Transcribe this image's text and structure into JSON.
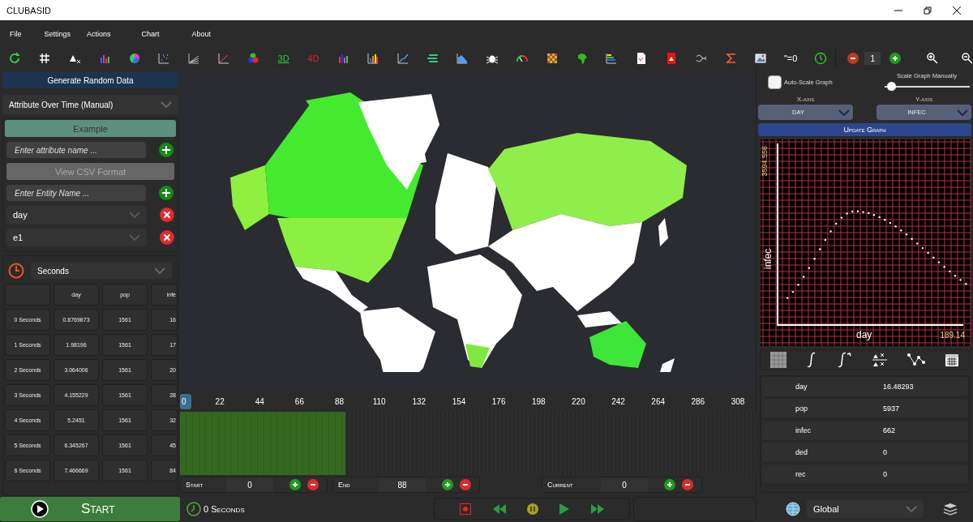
{
  "window": {
    "title": "CLUBASID"
  },
  "menu": [
    "File",
    "Settings",
    "Actions",
    "Chart",
    "About"
  ],
  "toolbar": {
    "three_d": "3D",
    "four_d": "4D",
    "equation": "\"=0",
    "counter": "1"
  },
  "left_panel": {
    "generate_button": "Generate Random Data",
    "mode_dropdown": "Attribute Over Time (Manual)",
    "example_button": "Example",
    "attribute_field": {
      "placeholder": "Enter attribute name ..."
    },
    "csv_button": "View CSV Format",
    "entity_field": {
      "placeholder": "Enter Entity Name ..."
    },
    "entries": [
      "day",
      "e1"
    ],
    "time_unit": "Seconds"
  },
  "table": {
    "columns": [
      "day",
      "pop",
      "infe"
    ],
    "rows": [
      {
        "label": "0 Seconds",
        "cells": [
          "0.8769873",
          "1561",
          "16"
        ]
      },
      {
        "label": "1 Seconds",
        "cells": [
          "1.98196",
          "1561",
          "17"
        ]
      },
      {
        "label": "2 Seconds",
        "cells": [
          "3.064006",
          "1561",
          "20"
        ]
      },
      {
        "label": "3 Seconds",
        "cells": [
          "4.155229",
          "1561",
          "28"
        ]
      },
      {
        "label": "4 Seconds",
        "cells": [
          "5.2451",
          "1561",
          "32"
        ]
      },
      {
        "label": "5 Seconds",
        "cells": [
          "6.345267",
          "1561",
          "45"
        ]
      },
      {
        "label": "6 Seconds",
        "cells": [
          "7.466669",
          "1561",
          "84"
        ]
      }
    ]
  },
  "timeline": {
    "ticks": [
      "0",
      "22",
      "44",
      "66",
      "88",
      "110",
      "132",
      "154",
      "176",
      "198",
      "220",
      "242",
      "264",
      "286",
      "308"
    ],
    "level": 0.287,
    "start": {
      "label": "Start",
      "value": "0"
    },
    "end": {
      "label": "End",
      "value": "88"
    },
    "current": {
      "label": "Current",
      "value": "0"
    }
  },
  "graph_panel": {
    "auto_scale": {
      "label": "Auto-Scale Graph",
      "checked": false
    },
    "scale_slider": {
      "label": "Scale Graph Manually",
      "level": 0.05
    },
    "x_axis": {
      "label": "X-axis",
      "value": "DAY"
    },
    "y_axis": {
      "label": "Y-axis",
      "value": "INFEC"
    },
    "update_button": "Update Graph",
    "graph": {
      "y_max": "3594.556",
      "x_max": "189.14",
      "y_label": "infec",
      "x_label": "day"
    },
    "readings": [
      {
        "name": "day",
        "value": "16.48293"
      },
      {
        "name": "pop",
        "value": "5937"
      },
      {
        "name": "infec",
        "value": "662"
      },
      {
        "name": "ded",
        "value": "0"
      },
      {
        "name": "rec",
        "value": "0"
      }
    ]
  },
  "bottom_bar": {
    "start_button": "Start",
    "elapsed": "0 Seconds",
    "region": "Global"
  }
}
